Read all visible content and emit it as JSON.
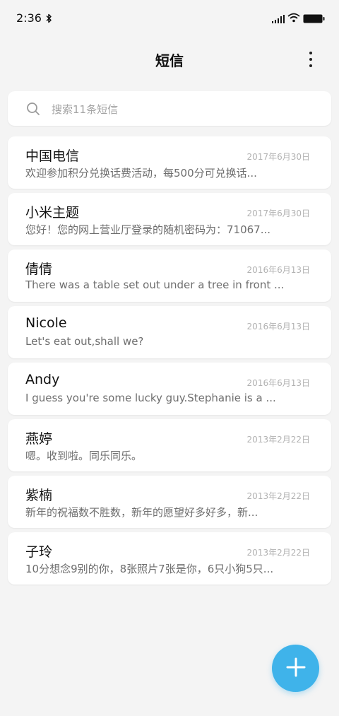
{
  "status_bar": {
    "time": "2:36",
    "icons": [
      "bluetooth-icon",
      "signal-icon",
      "wifi-icon",
      "battery-icon"
    ]
  },
  "header": {
    "title": "短信",
    "menu_icon": "more-vertical-icon"
  },
  "search": {
    "placeholder": "搜索11条短信",
    "icon": "search-icon"
  },
  "conversations": [
    {
      "name": "中国电信",
      "date": "2017年6月30日",
      "preview": "欢迎参加积分兑换话费活动，每500分可兑换话..."
    },
    {
      "name": "小米主题",
      "date": "2017年6月30日",
      "preview": "您好！您的网上营业厅登录的随机密码为：71067..."
    },
    {
      "name": "倩倩",
      "date": "2016年6月13日",
      "preview": "There was a table set out under a tree in front ..."
    },
    {
      "name": "Nicole",
      "date": "2016年6月13日",
      "preview": "Let's eat out,shall we?"
    },
    {
      "name": "Andy",
      "date": "2016年6月13日",
      "preview": "I guess you're some lucky guy.Stephanie is a ..."
    },
    {
      "name": "燕婷",
      "date": "2013年2月22日",
      "preview": "嗯。收到啦。同乐同乐。"
    },
    {
      "name": "紫楠",
      "date": "2013年2月22日",
      "preview": "新年的祝福数不胜数，新年的愿望好多好多，新..."
    },
    {
      "name": "子玲",
      "date": "2013年2月22日",
      "preview": "10分想念9别的你，8张照片7张是你，6只小狗5只..."
    }
  ],
  "fab": {
    "icon": "plus-icon"
  },
  "colors": {
    "accent": "#3fb3ea",
    "background": "#f4f4f4"
  }
}
